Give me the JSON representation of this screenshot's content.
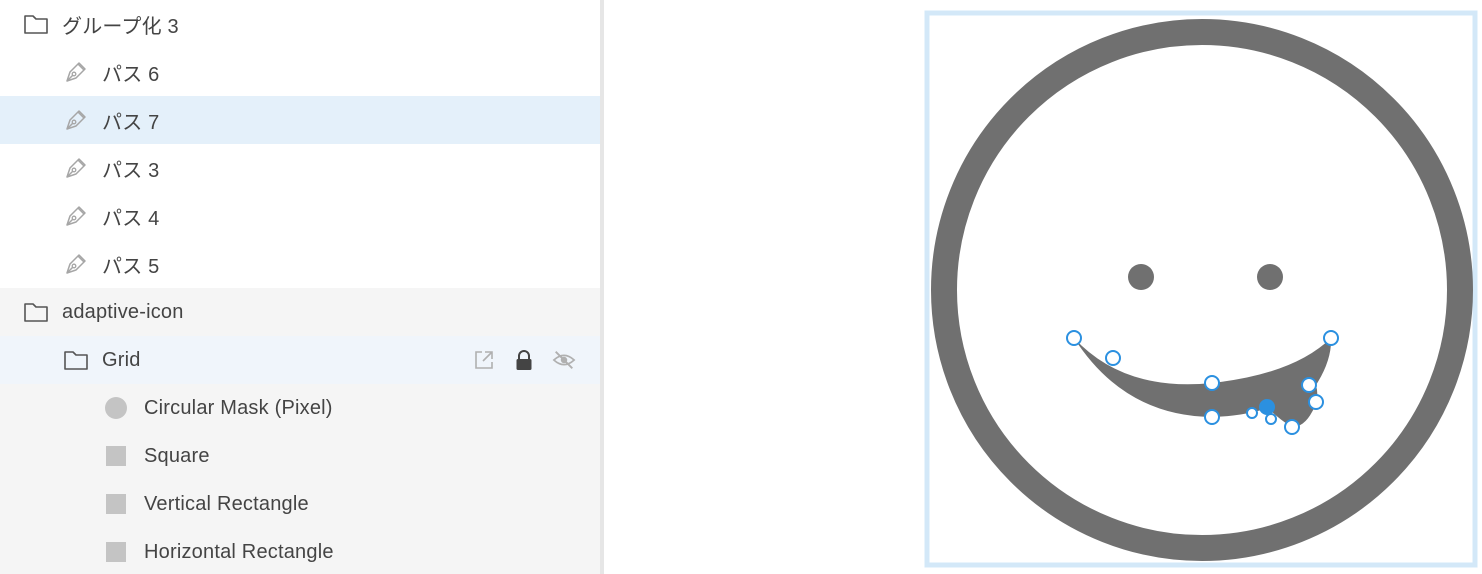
{
  "layers_panel": {
    "rows": [
      {
        "label": "グループ化 3",
        "icon": "folder-icon",
        "level": 0
      },
      {
        "label": "パス 6",
        "icon": "pen-path-icon",
        "level": 1
      },
      {
        "label": "パス 7",
        "icon": "pen-path-icon",
        "level": 1,
        "selected": true
      },
      {
        "label": "パス 3",
        "icon": "pen-path-icon",
        "level": 1
      },
      {
        "label": "パス 4",
        "icon": "pen-path-icon",
        "level": 1
      },
      {
        "label": "パス 5",
        "icon": "pen-path-icon",
        "level": 1
      },
      {
        "label": "adaptive-icon",
        "icon": "folder-icon",
        "level": 0
      },
      {
        "label": "Grid",
        "icon": "folder-icon",
        "level": 1,
        "actions": [
          "external-link-icon",
          "lock-icon",
          "hidden-eye-icon"
        ]
      },
      {
        "label": "Circular Mask (Pixel)",
        "icon": "circle-shape-icon",
        "level": 2
      },
      {
        "label": "Square",
        "icon": "square-shape-icon",
        "level": 2
      },
      {
        "label": "Vertical Rectangle",
        "icon": "square-shape-icon",
        "level": 2
      },
      {
        "label": "Horizontal Rectangle",
        "icon": "square-shape-icon",
        "level": 2
      }
    ]
  },
  "colors": {
    "selection_row": "#e4f0fa",
    "group_row": "#f5f5f5",
    "shape_gray": "#707070",
    "selection_blue": "#2b90e0",
    "artboard_border": "#d3e8f8",
    "icon_gray": "#9b9b9b"
  },
  "canvas": {
    "artboard": "smiley-face",
    "selected_path": "パス 7"
  }
}
